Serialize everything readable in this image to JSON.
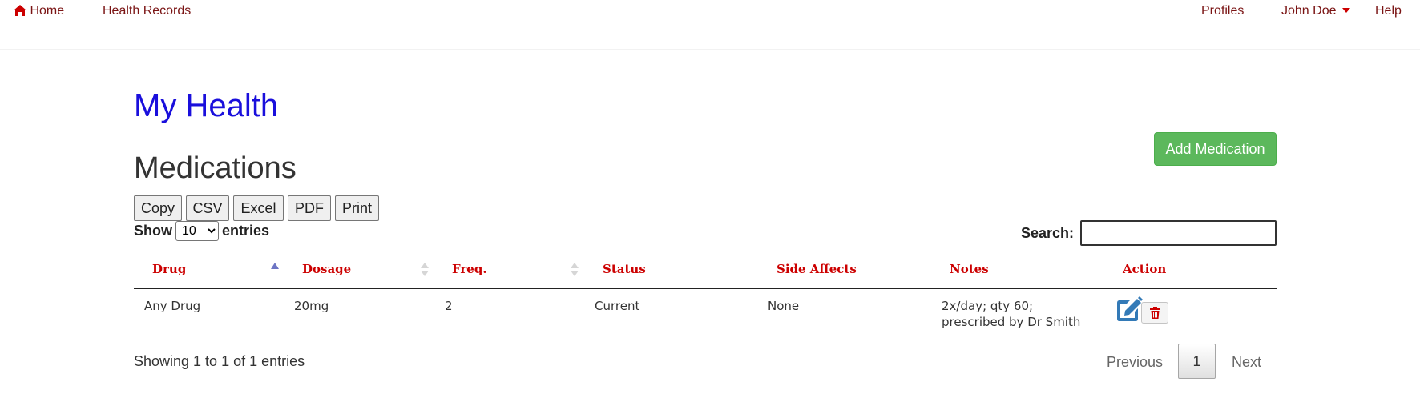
{
  "nav": {
    "home": "Home",
    "health_records": "Health Records",
    "profiles": "Profiles",
    "user": "John Doe",
    "help": "Help"
  },
  "page": {
    "title": "My Health",
    "section": "Medications",
    "add_button": "Add Medication"
  },
  "export_buttons": [
    "Copy",
    "CSV",
    "Excel",
    "PDF",
    "Print"
  ],
  "length": {
    "show": "Show",
    "selected": "10",
    "entries": "entries"
  },
  "search": {
    "label": "Search:",
    "value": ""
  },
  "table": {
    "columns": [
      "Drug",
      "Dosage",
      "Freq.",
      "Status",
      "Side Affects",
      "Notes",
      "Action"
    ],
    "sorted_column": "Drug",
    "sort_direction": "ascending",
    "rows": [
      {
        "drug": "Any Drug",
        "dosage": "20mg",
        "freq": "2",
        "status": "Current",
        "side_affects": "None",
        "notes_line1": "2x/day; qty 60;",
        "notes_line2": "prescribed by Dr Smith",
        "actions": [
          "edit-icon",
          "trash-icon"
        ]
      }
    ]
  },
  "footer": {
    "info": "Showing 1 to 1 of 1 entries",
    "previous": "Previous",
    "current_page": "1",
    "next": "Next"
  },
  "colors": {
    "nav_link": "#7a1414",
    "title": "#1a0fdc",
    "header_text": "#cc0000",
    "add_button": "#5cb85c",
    "edit_icon": "#337ab7",
    "trash_icon": "#cc0000"
  }
}
